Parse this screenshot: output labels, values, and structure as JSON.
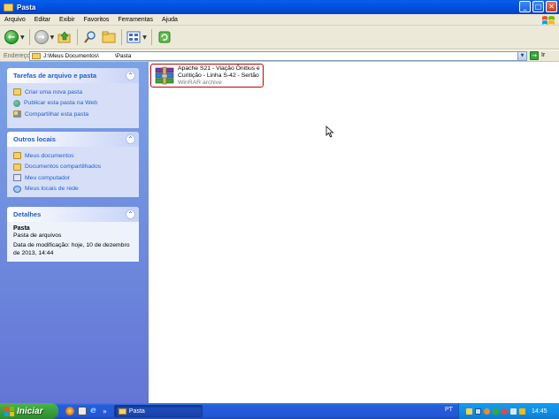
{
  "window": {
    "title": "Pasta",
    "buttons": {
      "minimize": "_",
      "maximize": "□",
      "close": "✕"
    }
  },
  "menu": [
    "Arquivo",
    "Editar",
    "Exibir",
    "Favoritos",
    "Ferramentas",
    "Ajuda"
  ],
  "address": {
    "label": "Endereço",
    "path": "J:\\Meus Documentos\\          \\Pasta",
    "go_label": "Ir"
  },
  "tasks_panel": {
    "title": "Tarefas de arquivo e pasta",
    "items": [
      "Criar uma nova pasta",
      "Publicar esta pasta na Web",
      "Compartilhar esta pasta"
    ]
  },
  "places_panel": {
    "title": "Outros locais",
    "items": [
      "Meus documentos",
      "Documentos compartilhados",
      "Meu computador",
      "Meus locais de rede"
    ]
  },
  "details_panel": {
    "title": "Detalhes",
    "name": "Pasta",
    "type": "Pasta de arquivos",
    "modified": "Data de modificação: hoje, 10 de dezembro de 2013, 14:44"
  },
  "file": {
    "name_line1": "Apache S21 - Viação Ônibus e",
    "name_line2": "Curitição - Linha S-42 - Sertão",
    "type": "WinRAR archive"
  },
  "taskbar": {
    "start_label": "Iniciar",
    "task_button": "Pasta",
    "language": "PT",
    "clock": "14:45",
    "quick_more": "»"
  },
  "colors": {
    "titlebar": "#0053e3",
    "leftpane": "#6f8ee0",
    "start": "#3a9f3a",
    "link": "#215dc6"
  }
}
